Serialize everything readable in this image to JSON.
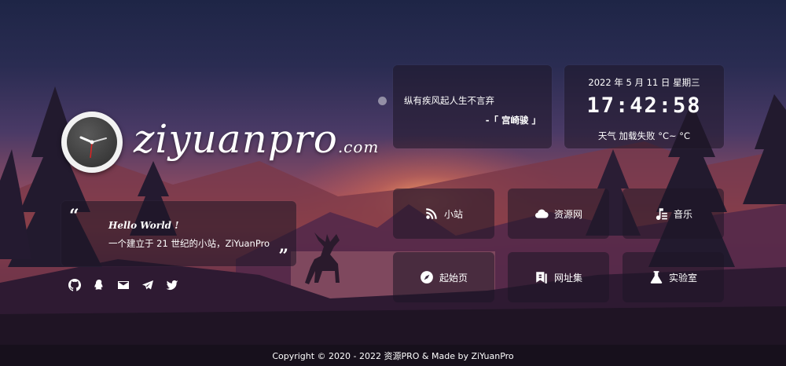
{
  "logo": {
    "name": "ziyuanpro",
    "suffix": ".com"
  },
  "hello": {
    "title": "Hello World !",
    "subtitle": "一个建立于 21 世纪的小站，ZiYuanPro",
    "quote_open": "“",
    "quote_close": "”"
  },
  "social": [
    "github-icon",
    "qq-icon",
    "mail-icon",
    "telegram-icon",
    "twitter-icon"
  ],
  "quote": {
    "text": "纵有疾风起人生不言弃",
    "author": "-「 宫崎骏 」"
  },
  "time": {
    "date": "2022 年 5 月 11 日 星期三",
    "clock": "17:42:58",
    "weather": "天气   加载失败   °C~ °C"
  },
  "links": [
    {
      "label": "小站",
      "icon": "blog-icon"
    },
    {
      "label": "资源网",
      "icon": "cloud-icon"
    },
    {
      "label": "音乐",
      "icon": "music-icon"
    },
    {
      "label": "起始页",
      "icon": "compass-icon"
    },
    {
      "label": "网址集",
      "icon": "bookmark-icon"
    },
    {
      "label": "实验室",
      "icon": "flask-icon"
    }
  ],
  "footer": {
    "text": "Copyright © 2020 - 2022 资源PRO &   Made by ZiYuanPro"
  }
}
